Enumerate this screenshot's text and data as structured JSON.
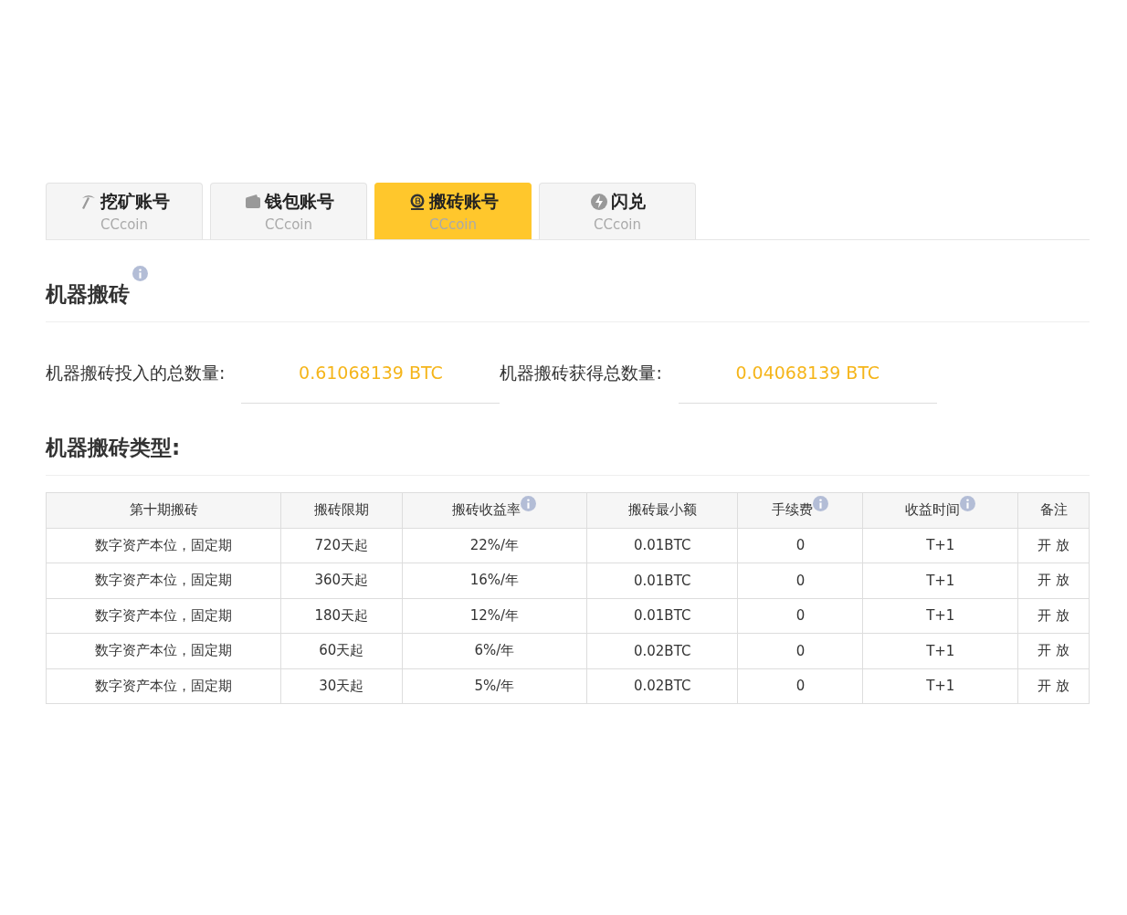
{
  "tabs": [
    {
      "kind": "pickaxe",
      "label": "挖矿账号",
      "sub": "CCcoin",
      "selected": false
    },
    {
      "kind": "wallet",
      "label": "钱包账号",
      "sub": "CCcoin",
      "selected": false
    },
    {
      "kind": "coin",
      "label": "搬砖账号",
      "sub": "CCcoin",
      "selected": true
    },
    {
      "kind": "bolt",
      "label": "闪兑",
      "sub": "CCcoin",
      "selected": false
    }
  ],
  "section_title": "机器搬砖",
  "stats": [
    {
      "label": "机器搬砖投入的总数量:",
      "value": "0.61068139 BTC"
    },
    {
      "label": "机器搬砖获得总数量:",
      "value": "0.04068139 BTC"
    }
  ],
  "types_title": "机器搬砖类型:",
  "table": {
    "columns": [
      {
        "label": "第十期搬砖",
        "info": false
      },
      {
        "label": "搬砖限期",
        "info": false
      },
      {
        "label": "搬砖收益率",
        "info": true
      },
      {
        "label": "搬砖最小额",
        "info": false
      },
      {
        "label": "手续费",
        "info": true
      },
      {
        "label": "收益时间",
        "info": true
      },
      {
        "label": "备注",
        "info": false
      }
    ],
    "rows": [
      [
        "数字资产本位，固定期",
        "720天起",
        "22%/年",
        "0.01BTC",
        "0",
        "T+1",
        "开 放"
      ],
      [
        "数字资产本位，固定期",
        "360天起",
        "16%/年",
        "0.01BTC",
        "0",
        "T+1",
        "开 放"
      ],
      [
        "数字资产本位，固定期",
        "180天起",
        "12%/年",
        "0.01BTC",
        "0",
        "T+1",
        "开 放"
      ],
      [
        "数字资产本位，固定期",
        "60天起",
        "6%/年",
        "0.02BTC",
        "0",
        "T+1",
        "开 放"
      ],
      [
        "数字资产本位，固定期",
        "30天起",
        "5%/年",
        "0.02BTC",
        "0",
        "T+1",
        "开 放"
      ]
    ]
  }
}
